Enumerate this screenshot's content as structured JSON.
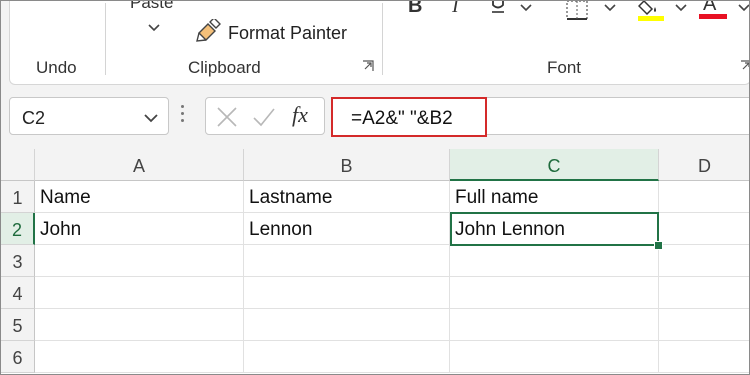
{
  "ribbon": {
    "paste_label": "Paste",
    "format_painter_label": "Format Painter",
    "groups": {
      "undo": "Undo",
      "clipboard": "Clipboard",
      "font": "Font"
    },
    "font_buttons": {
      "bold": "B",
      "italic": "I",
      "color": "A"
    },
    "highlight_color": "#ffff00",
    "font_color": "#e81123"
  },
  "formula_bar": {
    "name_box": "C2",
    "fx_label": "fx",
    "formula": "=A2&\" \"&B2"
  },
  "sheet": {
    "columns": [
      "A",
      "B",
      "C",
      "D"
    ],
    "rows": [
      "1",
      "2",
      "3",
      "4",
      "5",
      "6"
    ],
    "cells": {
      "A1": "Name",
      "B1": "Lastname",
      "C1": "Full name",
      "A2": "John",
      "B2": "Lennon",
      "C2": "John Lennon"
    },
    "selected_cell": "C2",
    "accent_color": "#217346"
  }
}
